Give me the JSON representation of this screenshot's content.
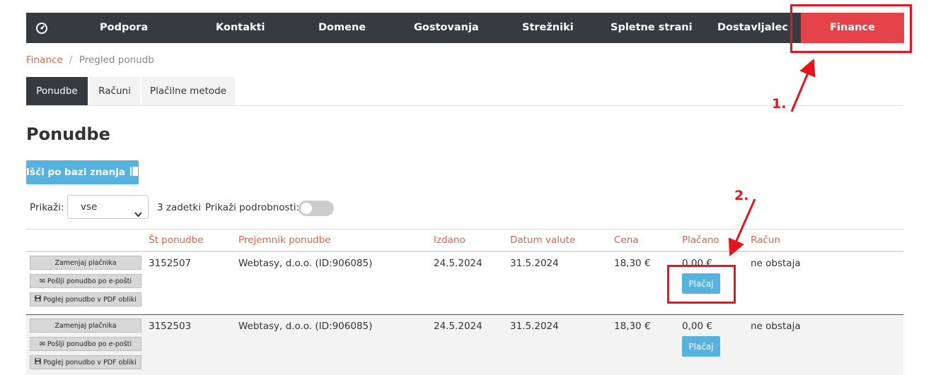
{
  "nav": {
    "items": [
      "Podpora",
      "Kontakti",
      "Domene",
      "Gostovanja",
      "Strežniki",
      "Spletne strani",
      "Dostavljalec"
    ],
    "active": "Finance"
  },
  "breadcrumb": {
    "parent": "Finance",
    "separator": "/",
    "current": "Pregled ponudb"
  },
  "tabs": [
    "Ponudbe",
    "Računi",
    "Plačilne metode"
  ],
  "page_title": "Ponudbe",
  "kb_button": "Išči po bazi znanja",
  "filter": {
    "label": "Prikaži:",
    "value": "vse",
    "count": "3 zadetki",
    "details_label": "Prikaži podrobnosti:"
  },
  "table": {
    "headers": [
      "Št ponudbe",
      "Prejemnik ponudbe",
      "Izdano",
      "Datum valute",
      "Cena",
      "Plačano",
      "Račun"
    ],
    "actions": [
      "Zamenjaj plačnika",
      "Pošlji ponudbo po e-pošti",
      "Poglej ponudbo v PDF obliki"
    ],
    "pay_label": "Plačaj",
    "rows": [
      {
        "number": "3152507",
        "recipient": "Webtasy, d.o.o. (ID:906085)",
        "issued": "24.5.2024",
        "due": "31.5.2024",
        "price": "18,30 €",
        "paid": "0,00 €",
        "invoice": "ne obstaja"
      },
      {
        "number": "3152503",
        "recipient": "Webtasy, d.o.o. (ID:906085)",
        "issued": "24.5.2024",
        "due": "31.5.2024",
        "price": "18,30 €",
        "paid": "0,00 €",
        "invoice": "ne obstaja"
      }
    ]
  },
  "annotations": {
    "step1": "1.",
    "step2": "2."
  },
  "colors": {
    "nav_bg": "#353b3f",
    "finance": "#e5434a",
    "accent_text": "#e0644c",
    "button_blue": "#56b3df",
    "annotation_red": "#e8131c"
  }
}
